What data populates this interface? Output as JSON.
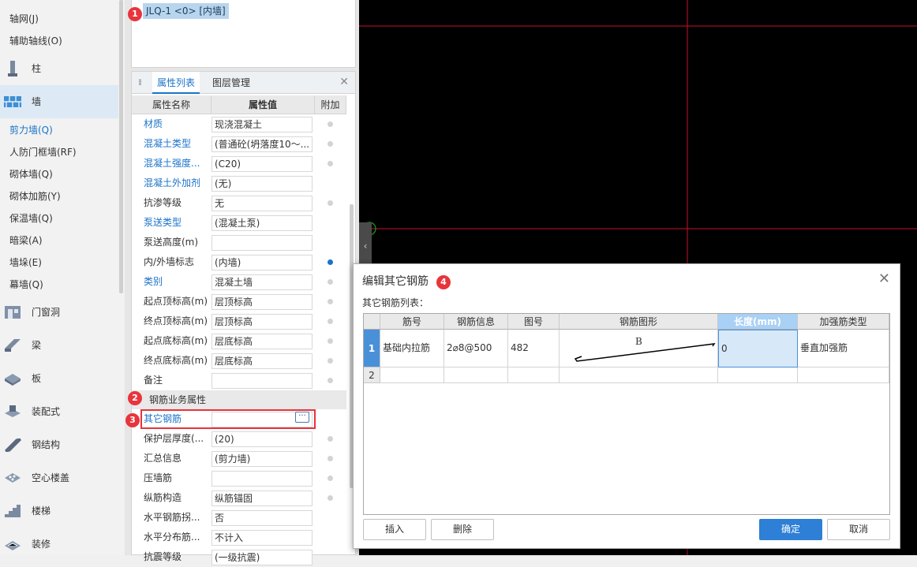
{
  "left_nav": {
    "top_items": [
      {
        "label": "轴网(J)"
      },
      {
        "label": "辅助轴线(O)"
      }
    ],
    "categories": [
      {
        "label": "柱",
        "icon": "column-icon"
      },
      {
        "label": "墙",
        "icon": "wall-icon"
      },
      {
        "label": "门窗洞",
        "icon": "door-window-icon"
      },
      {
        "label": "梁",
        "icon": "beam-icon"
      },
      {
        "label": "板",
        "icon": "slab-icon"
      },
      {
        "label": "装配式",
        "icon": "prefab-icon"
      },
      {
        "label": "钢结构",
        "icon": "steel-structure-icon"
      },
      {
        "label": "空心楼盖",
        "icon": "hollow-floor-icon"
      },
      {
        "label": "楼梯",
        "icon": "stair-icon"
      },
      {
        "label": "装修",
        "icon": "decoration-icon"
      }
    ],
    "wall_sub_items": [
      {
        "label": "剪力墙(Q)"
      },
      {
        "label": "人防门框墙(RF)"
      },
      {
        "label": "砌体墙(Q)"
      },
      {
        "label": "砌体加筋(Y)"
      },
      {
        "label": "保温墙(Q)"
      },
      {
        "label": "暗梁(A)"
      },
      {
        "label": "墙垛(E)"
      },
      {
        "label": "幕墙(Q)"
      }
    ]
  },
  "layer_list": {
    "selected": "JLQ-1 <0> [内墙]"
  },
  "property_panel": {
    "tabs": [
      "属性列表",
      "图层管理"
    ],
    "headers": {
      "name": "属性名称",
      "value": "属性值",
      "extra": "附加"
    },
    "rows": [
      {
        "name": "材质",
        "value": "现浇混凝土"
      },
      {
        "name": "混凝土类型",
        "value": "(普通砼(坍落度10～..."
      },
      {
        "name": "混凝土强度...",
        "value": "(C20)"
      },
      {
        "name": "混凝土外加剂",
        "value": "(无)"
      },
      {
        "name": "抗渗等级",
        "value": "无"
      },
      {
        "name": "泵送类型",
        "value": "(混凝土泵)"
      },
      {
        "name": "泵送高度(m)",
        "value": ""
      },
      {
        "name": "内/外墙标志",
        "value": "(内墙)"
      },
      {
        "name": "类别",
        "value": "混凝土墙"
      },
      {
        "name": "起点顶标高(m)",
        "value": "层顶标高"
      },
      {
        "name": "终点顶标高(m)",
        "value": "层顶标高"
      },
      {
        "name": "起点底标高(m)",
        "value": "层底标高"
      },
      {
        "name": "终点底标高(m)",
        "value": "层底标高"
      },
      {
        "name": "备注",
        "value": ""
      }
    ],
    "group_label": "钢筋业务属性",
    "rebar_rows": [
      {
        "name": "其它钢筋",
        "value": ""
      },
      {
        "name": "保护层厚度(...",
        "value": "(20)"
      },
      {
        "name": "汇总信息",
        "value": "(剪力墙)"
      },
      {
        "name": "压墙筋",
        "value": ""
      },
      {
        "name": "纵筋构造",
        "value": "纵筋锚固"
      },
      {
        "name": "水平钢筋拐...",
        "value": "否"
      },
      {
        "name": "水平分布筋...",
        "value": "不计入"
      },
      {
        "name": "抗震等级",
        "value": "(一级抗震)"
      }
    ],
    "ellipsis": "···"
  },
  "badges": [
    "1",
    "2",
    "3",
    "4"
  ],
  "dialog": {
    "title": "编辑其它钢筋",
    "subtitle": "其它钢筋列表：",
    "columns": [
      "筋号",
      "钢筋信息",
      "图号",
      "钢筋图形",
      "长度(mm)",
      "加强筋类型"
    ],
    "rows": [
      {
        "index": "1",
        "bar_no": "基础内拉筋",
        "info": "2⌀8@500",
        "fig": "482",
        "shape_label": "B",
        "length": "0",
        "type": "垂直加强筋"
      },
      {
        "index": "2",
        "bar_no": "",
        "info": "",
        "fig": "",
        "shape_label": "",
        "length": "",
        "type": ""
      }
    ],
    "buttons": {
      "insert": "插入",
      "delete": "删除",
      "ok": "确定",
      "cancel": "取消"
    }
  },
  "colors": {
    "accent": "#1a73c8",
    "badge": "#e8343c",
    "canvas": "#000000",
    "axis": "#c8102e"
  }
}
